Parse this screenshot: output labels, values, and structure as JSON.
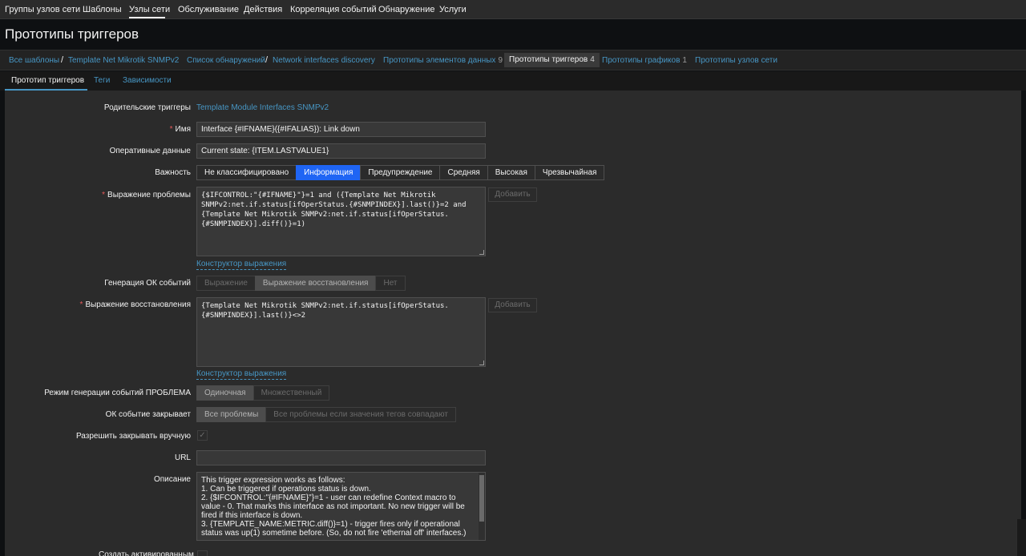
{
  "topnav": {
    "items": [
      {
        "label": "Группы узлов сети"
      },
      {
        "label": "Шаблоны"
      },
      {
        "label": "Узлы сети"
      },
      {
        "label": "Обслуживание"
      },
      {
        "label": "Действия"
      },
      {
        "label": "Корреляция событий"
      },
      {
        "label": "Обнаружение"
      },
      {
        "label": "Услуги"
      }
    ],
    "active": "Узлы сети"
  },
  "page_title": "Прототипы триггеров",
  "breadcrumbs": {
    "all_templates": "Все шаблоны",
    "template": "Template Net Mikrotik SNMPv2",
    "discovery_list": "Список обнаружений",
    "discovery_rule": "Network interfaces discovery",
    "item_prototypes": {
      "label": "Прототипы элементов данных",
      "count": "9"
    },
    "trigger_prototypes": {
      "label": "Прототипы триггеров",
      "count": "4"
    },
    "graph_prototypes": {
      "label": "Прототипы графиков",
      "count": "1"
    },
    "host_prototypes": {
      "label": "Прототипы узлов сети"
    },
    "separator": "/"
  },
  "form_tabs": {
    "trigger": "Прототип триггеров",
    "tags": "Теги",
    "dependencies": "Зависимости"
  },
  "form": {
    "parent_triggers": {
      "label": "Родительские триггеры",
      "value": "Template Module Interfaces SNMPv2"
    },
    "name": {
      "label": "Имя",
      "value": "Interface {#IFNAME}({#IFALIAS}): Link down"
    },
    "opdata": {
      "label": "Оперативные данные",
      "value": "Current state: {ITEM.LASTVALUE1}"
    },
    "severity": {
      "label": "Важность",
      "options": [
        "Не классифицировано",
        "Информация",
        "Предупреждение",
        "Средняя",
        "Высокая",
        "Чрезвычайная"
      ],
      "selected": "Информация",
      "selected_color": "#1f65f4"
    },
    "problem_expression": {
      "label": "Выражение проблемы",
      "value": "{$IFCONTROL:\"{#IFNAME}\"}=1 and ({Template Net Mikrotik SNMPv2:net.if.status[ifOperStatus.{#SNMPINDEX}].last()}=2 and {Template Net Mikrotik SNMPv2:net.if.status[ifOperStatus.{#SNMPINDEX}].diff()}=1)",
      "add_button": "Добавить",
      "constructor_link": "Конструктор выражения"
    },
    "ok_event_generation": {
      "label": "Генерация ОК событий",
      "options": [
        "Выражение",
        "Выражение восстановления",
        "Нет"
      ],
      "selected": "Выражение восстановления"
    },
    "recovery_expression": {
      "label": "Выражение восстановления",
      "value": "{Template Net Mikrotik SNMPv2:net.if.status[ifOperStatus.{#SNMPINDEX}].last()}<>2",
      "add_button": "Добавить",
      "constructor_link": "Конструктор выражения"
    },
    "problem_event_mode": {
      "label": "Режим генерации событий ПРОБЛЕМА",
      "options": [
        "Одиночная",
        "Множественный"
      ],
      "selected": "Одиночная"
    },
    "ok_event_closes": {
      "label": "ОК событие закрывает",
      "options": [
        "Все проблемы",
        "Все проблемы если значения тегов совпадают"
      ],
      "selected": "Все проблемы"
    },
    "manual_close": {
      "label": "Разрешить закрывать вручную",
      "checked": true,
      "check_glyph": "✓"
    },
    "url": {
      "label": "URL",
      "value": ""
    },
    "description": {
      "label": "Описание",
      "lines": [
        "This trigger expression works as follows:",
        "1. Can be triggered if operations status is down.",
        "2. {$IFCONTROL:\"{#IFNAME}\"}=1 - user can redefine Context macro to value - 0. That marks this interface as not important. No new trigger will be fired if this interface is down.",
        "3. {TEMPLATE_NAME:METRIC.diff()}=1) - trigger fires only if operational status was up(1) sometime before. (So, do not fire 'ethernal off' interfaces.)"
      ]
    },
    "cutoff_label": "Создать активированным"
  }
}
